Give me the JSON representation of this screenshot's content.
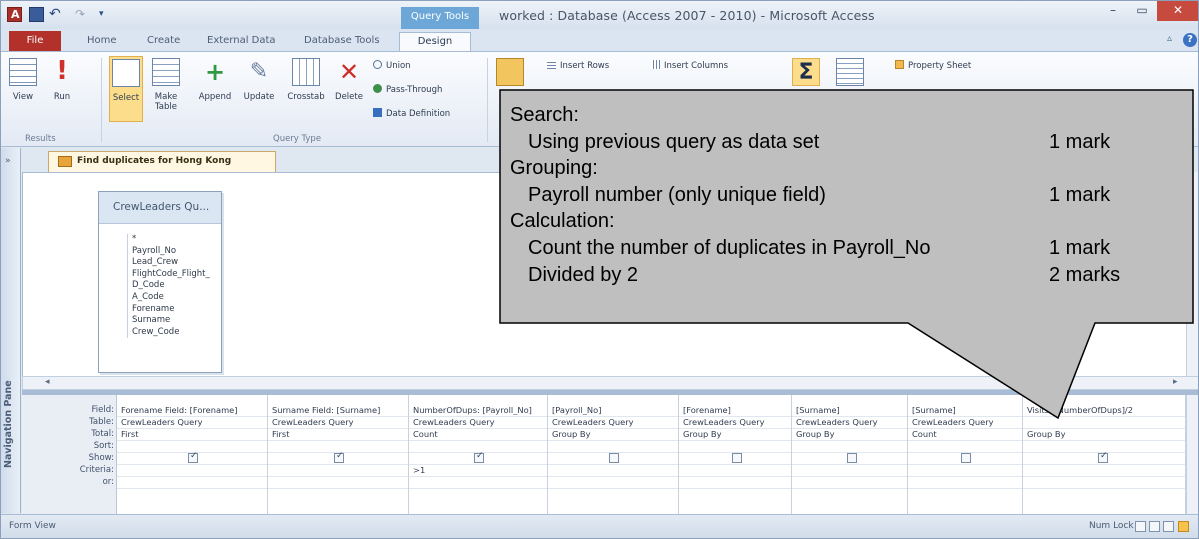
{
  "window": {
    "title": "worked : Database (Access 2007 - 2010) - Microsoft Access",
    "contextual_group": "Query Tools",
    "min": "–",
    "max": "▭",
    "close": "✕"
  },
  "tabs": {
    "file": "File",
    "home": "Home",
    "create": "Create",
    "external": "External Data",
    "dbtools": "Database Tools",
    "design": "Design"
  },
  "ribbon": {
    "results_group": "Results",
    "query_type_group": "Query Type",
    "view": "View",
    "run": "Run",
    "select": "Select",
    "make_table": "Make Table",
    "append": "Append",
    "update": "Update",
    "crosstab": "Crosstab",
    "delete": "Delete",
    "union": "Union",
    "pass_through": "Pass-Through",
    "data_definition": "Data Definition",
    "insert_rows": "Insert Rows",
    "insert_columns": "Insert Columns",
    "property_sheet": "Property Sheet"
  },
  "nav_pane": {
    "label": "Navigation Pane",
    "toggle": "»"
  },
  "document": {
    "tab_label": "Find duplicates for Hong Kong"
  },
  "table_box": {
    "title": "CrewLeaders Qu...",
    "fields": [
      "*",
      "Payroll_No",
      "Lead_Crew",
      "FlightCode_Flight_",
      "D_Code",
      "A_Code",
      "Forename",
      "Surname",
      "Crew_Code"
    ]
  },
  "qbe": {
    "row_headers": [
      "Field:",
      "Table:",
      "Total:",
      "Sort:",
      "Show:",
      "Criteria:",
      "or:"
    ],
    "columns": [
      {
        "field": "Forename Field: [Forename]",
        "table": "CrewLeaders Query",
        "total": "First",
        "show": true,
        "criteria": ""
      },
      {
        "field": "Surname Field: [Surname]",
        "table": "CrewLeaders Query",
        "total": "First",
        "show": true,
        "criteria": ""
      },
      {
        "field": "NumberOfDups: [Payroll_No]",
        "table": "CrewLeaders Query",
        "total": "Count",
        "show": true,
        "criteria": ">1"
      },
      {
        "field": "[Payroll_No]",
        "table": "CrewLeaders Query",
        "total": "Group By",
        "show": false,
        "criteria": ""
      },
      {
        "field": "[Forename]",
        "table": "CrewLeaders Query",
        "total": "Group By",
        "show": false,
        "criteria": ""
      },
      {
        "field": "[Surname]",
        "table": "CrewLeaders Query",
        "total": "Group By",
        "show": false,
        "criteria": ""
      },
      {
        "field": "[Surname]",
        "table": "CrewLeaders Query",
        "total": "Count",
        "show": false,
        "criteria": ""
      },
      {
        "field": "Visits: [NumberOfDups]/2",
        "table": "",
        "total": "Group By",
        "show": true,
        "criteria": ""
      }
    ]
  },
  "status": {
    "left": "Form View",
    "right": "Num Lock"
  },
  "callout": {
    "lines": [
      {
        "text": "Search:",
        "mark": "",
        "indent": false
      },
      {
        "text": "Using previous query as data set",
        "mark": "1 mark",
        "indent": true
      },
      {
        "text": "Grouping:",
        "mark": "",
        "indent": false
      },
      {
        "text": "Payroll number (only unique field)",
        "mark": "1 mark",
        "indent": true
      },
      {
        "text": "Calculation:",
        "mark": "",
        "indent": false
      },
      {
        "text": "Count the number of duplicates in Payroll_No",
        "mark": "1 mark",
        "indent": true
      },
      {
        "text": "Divided by 2",
        "mark": "2 marks",
        "indent": true
      }
    ]
  }
}
